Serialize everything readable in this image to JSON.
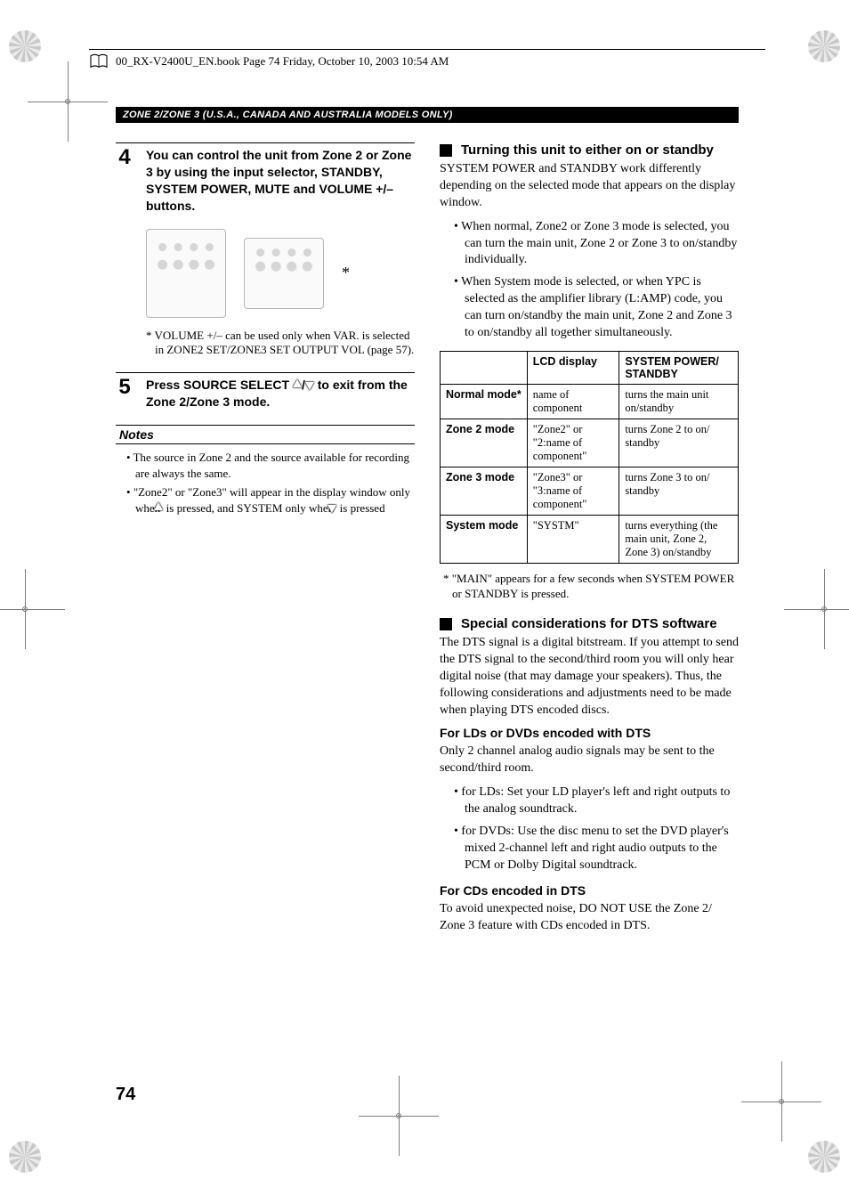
{
  "meta": {
    "header_line": "00_RX-V2400U_EN.book  Page 74  Friday, October 10, 2003  10:54 AM"
  },
  "banner": "ZONE 2/ZONE 3 (U.S.A., CANADA AND AUSTRALIA MODELS ONLY)",
  "step4": {
    "num": "4",
    "text": "You can control the unit from Zone 2 or Zone 3 by using the input selector, STANDBY, SYSTEM POWER, MUTE and VOLUME +/– buttons.",
    "footnote": "*   VOLUME +/– can be used only when VAR. is selected in ZONE2 SET/ZONE3 SET OUTPUT VOL (page 57).",
    "asterisk": "*"
  },
  "step5": {
    "num": "5",
    "pre": "Press SOURCE SELECT ",
    "mid": "/",
    "post": " to exit from the Zone 2/Zone 3 mode."
  },
  "notes": {
    "heading": "Notes",
    "items": [
      "The source in Zone 2 and the source available for recording are always the same.",
      "\"Zone2\" or \"Zone3\" will appear in the display window only when "
    ],
    "item2_mid": " is pressed, and SYSTEM only when ",
    "item2_end": " is pressed"
  },
  "right": {
    "h1": "Turning this unit to either on or standby",
    "p1": "SYSTEM POWER and STANDBY work differently depending on the selected mode that appears on the display window.",
    "b1": "When normal, Zone2 or Zone 3 mode is selected, you can turn the main unit, Zone 2 or Zone 3 to on/standby individually.",
    "b2": "When System mode is selected, or when YPC is selected as the amplifier library (L:AMP) code, you can turn on/standby the main unit, Zone 2 and Zone 3 to on/standby all together simultaneously.",
    "table": {
      "head_empty": "",
      "head_lcd": "LCD display",
      "head_sys": "SYSTEM POWER/ STANDBY",
      "rows": [
        {
          "mode": "Normal mode*",
          "lcd": "name of component",
          "sys": "turns the main unit on/standby"
        },
        {
          "mode": "Zone 2 mode",
          "lcd": "\"Zone2\" or \"2:name of component\"",
          "sys": "turns Zone 2 to on/ standby"
        },
        {
          "mode": "Zone 3 mode",
          "lcd": "\"Zone3\" or \"3:name of component\"",
          "sys": "turns Zone 3 to on/ standby"
        },
        {
          "mode": "System mode",
          "lcd": "\"SYSTM\"",
          "sys": "turns everything (the main unit, Zone 2, Zone 3) on/standby"
        }
      ]
    },
    "table_footnote": "*   \"MAIN\" appears for a few seconds when SYSTEM POWER or STANDBY is pressed.",
    "h2": "Special considerations for DTS software",
    "p2": "The DTS signal is a digital bitstream. If you attempt to send the DTS signal to the second/third room you will only hear digital noise (that may damage your speakers). Thus, the following considerations and adjustments need to be made when playing DTS encoded discs.",
    "sub1_h": "For LDs or DVDs encoded with DTS",
    "sub1_p": "Only 2 channel analog audio signals may be sent to the second/third room.",
    "sub1_b1": "for LDs: Set your LD player's left and right outputs to the analog soundtrack.",
    "sub1_b2": "for DVDs: Use the disc menu to set the DVD player's mixed 2-channel left and right audio outputs to the PCM or Dolby Digital soundtrack.",
    "sub2_h": "For CDs encoded in DTS",
    "sub2_p": "To avoid unexpected noise, DO NOT USE the Zone 2/ Zone 3 feature with CDs encoded in DTS."
  },
  "page_number": "74"
}
